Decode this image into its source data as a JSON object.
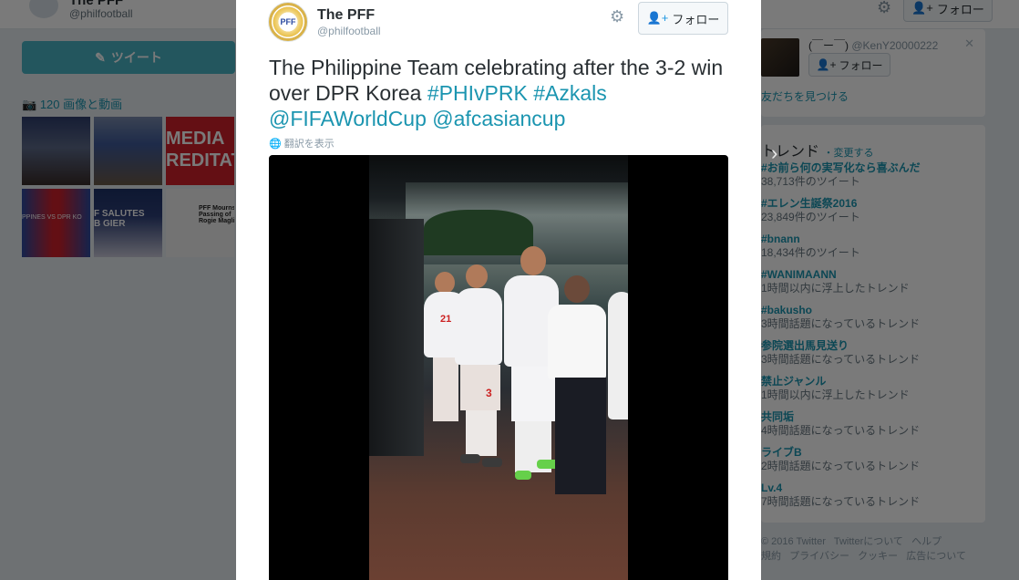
{
  "background": {
    "profile": {
      "name": "The PFF",
      "handle": "@philfootball",
      "follow_label": "フォロー"
    },
    "tweet_button": "ツイート",
    "media_count_label": "120 画像と動画",
    "thumbnails": [
      {
        "label": ""
      },
      {
        "label": ""
      },
      {
        "label": "MEDIA\nREDITAT"
      },
      {
        "label": "PPINES  VS  DPR KO"
      },
      {
        "label": "F SALUTES\nB GIER"
      },
      {
        "label": "PFF Mourns\nPassing of\nRogie Maglina"
      }
    ],
    "who_to_follow": {
      "name": "(￣ー￣)",
      "handle": "@KenY20000222",
      "follow_label": "フォロー",
      "find_friends": "友だちを見つける"
    },
    "trends": {
      "title": "トレンド",
      "change_label": "・変更する",
      "items": [
        {
          "name": "#お前ら何の実写化なら喜ぶんだ",
          "count": "38,713件のツイート"
        },
        {
          "name": "#エレン生誕祭2016",
          "count": "23,849件のツイート"
        },
        {
          "name": "#bnann",
          "count": "18,434件のツイート"
        },
        {
          "name": "#WANIMAANN",
          "count": "1時間以内に浮上したトレンド"
        },
        {
          "name": "#bakusho",
          "count": "3時間話題になっているトレンド"
        },
        {
          "name": "参院選出馬見送り",
          "count": "3時間話題になっているトレンド"
        },
        {
          "name": "禁止ジャンル",
          "count": "1時間以内に浮上したトレンド"
        },
        {
          "name": "共同垢",
          "count": "4時間話題になっているトレンド"
        },
        {
          "name": "ライブB",
          "count": "2時間話題になっているトレンド"
        },
        {
          "name": "Lv.4",
          "count": "7時間話題になっているトレンド"
        }
      ]
    },
    "footer": "© 2016 Twitter   Twitterについて   ヘルプ\n規約   プライバシー   クッキー   広告について"
  },
  "modal": {
    "author": {
      "name": "The PFF",
      "handle": "@philfootball",
      "avatar_text": "PFF"
    },
    "follow_label": "フォロー",
    "text_plain": "The Philippine Team celebrating after the 3-2 win over DPR Korea ",
    "links": [
      "#PHIvPRK",
      "#Azkals",
      "@FIFAWorldCup",
      "@afcasiancup"
    ],
    "translate_label": "翻訳を表示",
    "jersey_numbers": [
      "21",
      "3"
    ]
  },
  "colors": {
    "link": "#1b95b0",
    "tweet_button": "#4ab3c4",
    "overlay": "rgba(0,0,0,0.52)"
  }
}
